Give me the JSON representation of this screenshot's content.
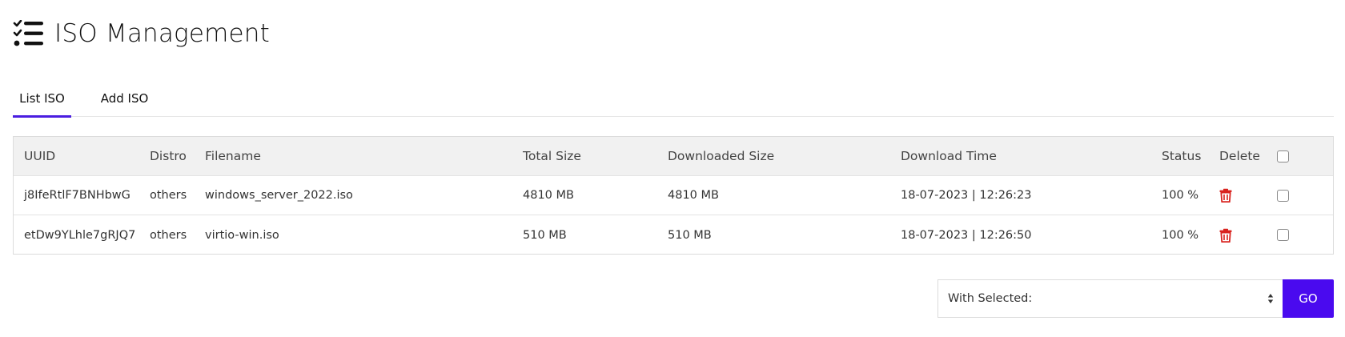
{
  "header": {
    "title": "ISO Management",
    "icon": "checklist-icon"
  },
  "tabs": [
    {
      "label": "List ISO",
      "active": true
    },
    {
      "label": "Add ISO",
      "active": false
    }
  ],
  "table": {
    "columns": [
      "UUID",
      "Distro",
      "Filename",
      "Total Size",
      "Downloaded Size",
      "Download Time",
      "Status",
      "Delete"
    ],
    "rows": [
      {
        "uuid": "j8IfeRtlF7BNHbwG",
        "distro": "others",
        "filename": "windows_server_2022.iso",
        "total_size": "4810 MB",
        "downloaded_size": "4810 MB",
        "download_time": "18-07-2023 | 12:26:23",
        "status": "100 %"
      },
      {
        "uuid": "etDw9YLhle7gRJQ7",
        "distro": "others",
        "filename": "virtio-win.iso",
        "total_size": "510 MB",
        "downloaded_size": "510 MB",
        "download_time": "18-07-2023 | 12:26:50",
        "status": "100 %"
      }
    ]
  },
  "bulk_action": {
    "selected_label": "With Selected:",
    "go_label": "GO"
  },
  "colors": {
    "accent": "#4a0aef",
    "tab_underline": "#4a1de0",
    "delete_icon": "#d9231f",
    "header_bg": "#f1f1f1"
  }
}
